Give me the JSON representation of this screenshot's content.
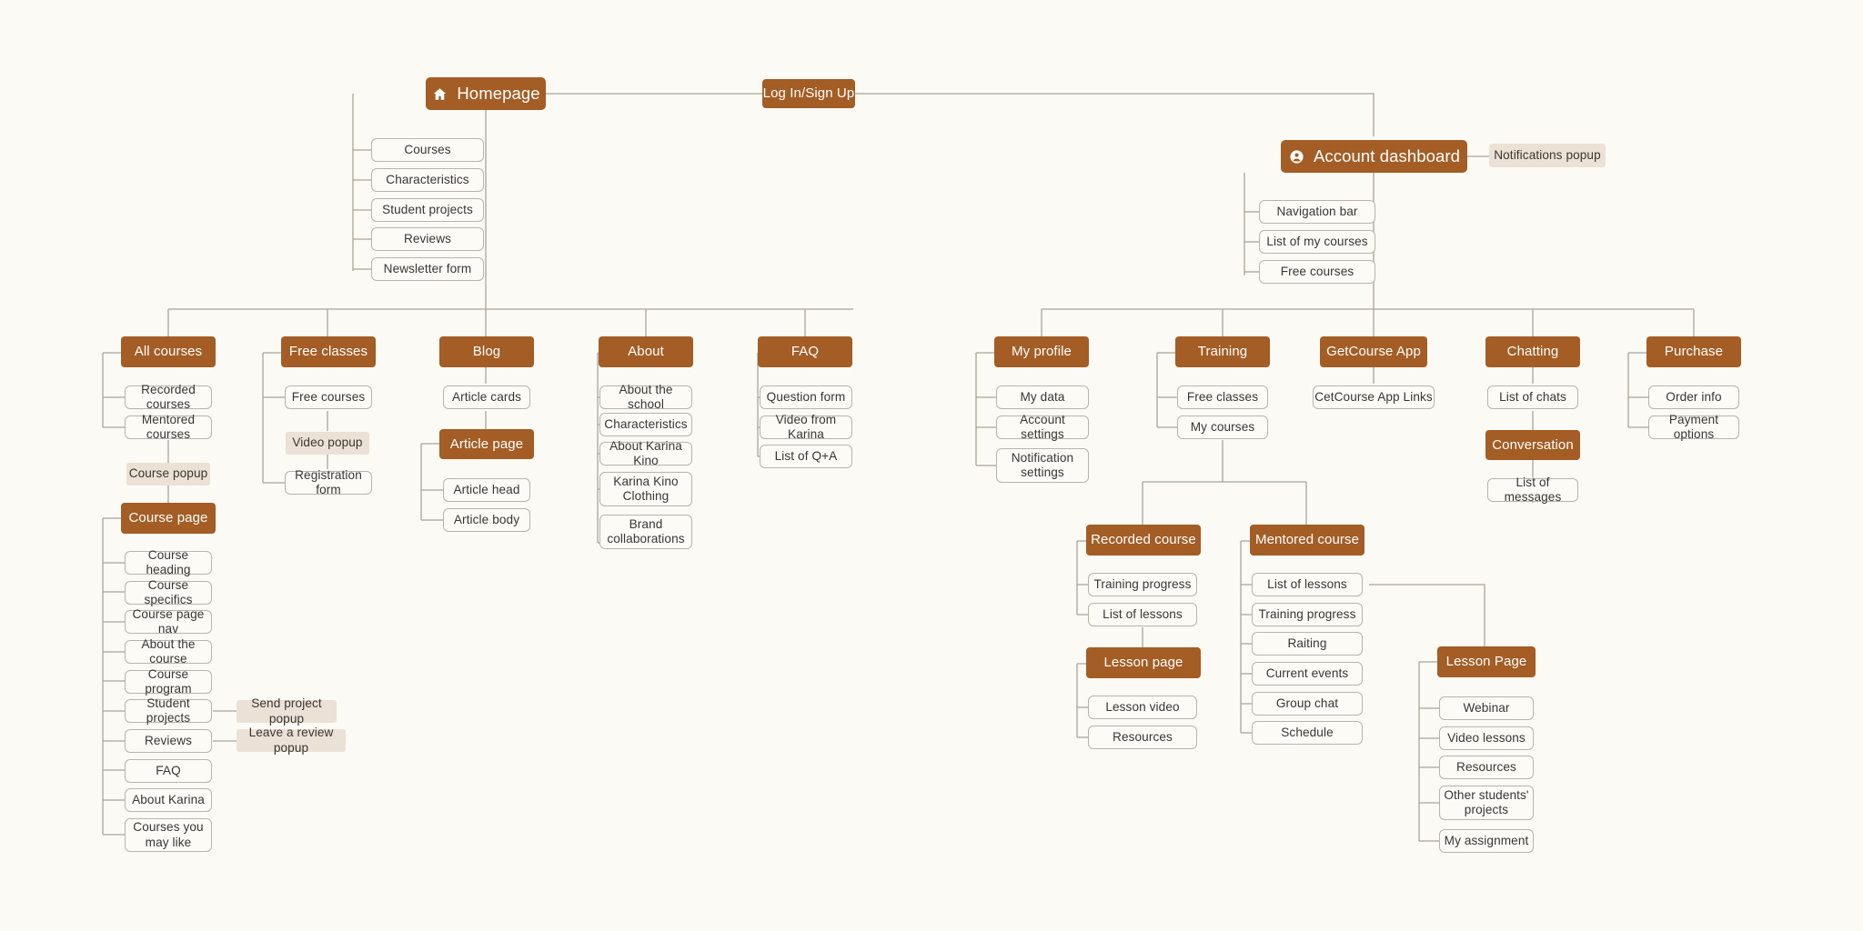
{
  "diagram": {
    "title": "Online course platform sitemap",
    "background_color": "#FBFAF4",
    "primary_color": "#A35D25",
    "popup_color": "#EBE1D6",
    "line_color": "#A9A49C"
  },
  "nodes": {
    "homepage": {
      "label": "Homepage",
      "icon": "home-icon"
    },
    "login": {
      "label": "Log In/Sign Up"
    },
    "account_dashboard": {
      "label": "Account dashboard",
      "icon": "user-account-icon"
    },
    "notifications_popup": {
      "label": "Notifications popup"
    },
    "home_children": [
      {
        "label": "Courses"
      },
      {
        "label": "Characteristics"
      },
      {
        "label": "Student projects"
      },
      {
        "label": "Reviews"
      },
      {
        "label": "Newsletter form"
      }
    ],
    "dashboard_children": [
      {
        "label": "Navigation bar"
      },
      {
        "label": "List of my courses"
      },
      {
        "label": "Free courses"
      }
    ],
    "all_courses": {
      "label": "All courses"
    },
    "all_courses_children": [
      {
        "label": "Recorded courses"
      },
      {
        "label": "Mentored courses"
      }
    ],
    "course_popup": {
      "label": "Course popup"
    },
    "course_page": {
      "label": "Course page"
    },
    "course_page_children": [
      {
        "label": "Course heading"
      },
      {
        "label": "Course specifics"
      },
      {
        "label": "Course page nav"
      },
      {
        "label": "About the course"
      },
      {
        "label": "Course program"
      },
      {
        "label": "Student projects"
      },
      {
        "label": "Reviews"
      },
      {
        "label": "FAQ"
      },
      {
        "label": "About Karina"
      },
      {
        "label": "Courses you\nmay like"
      }
    ],
    "send_project_popup": {
      "label": "Send project popup"
    },
    "leave_review_popup": {
      "label": "Leave a review popup"
    },
    "free_classes": {
      "label": "Free classes"
    },
    "free_classes_children": [
      {
        "label": "Free courses"
      },
      {
        "label": "Registration form"
      }
    ],
    "video_popup": {
      "label": "Video popup"
    },
    "blog": {
      "label": "Blog"
    },
    "article_cards": {
      "label": "Article cards"
    },
    "article_page": {
      "label": "Article page"
    },
    "article_page_children": [
      {
        "label": "Article head"
      },
      {
        "label": "Article body"
      }
    ],
    "about": {
      "label": "About"
    },
    "about_children": [
      {
        "label": "About the school"
      },
      {
        "label": "Characteristics"
      },
      {
        "label": "About Karina Kino"
      },
      {
        "label": "Karina Kino\nClothing"
      },
      {
        "label": "Brand\ncollaborations"
      }
    ],
    "faq": {
      "label": "FAQ"
    },
    "faq_children": [
      {
        "label": "Question form"
      },
      {
        "label": "Video from Karina"
      },
      {
        "label": "List of Q+A"
      }
    ],
    "my_profile": {
      "label": "My profile"
    },
    "my_profile_children": [
      {
        "label": "My data"
      },
      {
        "label": "Account settings"
      },
      {
        "label": "Notification\nsettings"
      }
    ],
    "training": {
      "label": "Training"
    },
    "training_children": [
      {
        "label": "Free classes"
      },
      {
        "label": "My courses"
      }
    ],
    "getcourse_app": {
      "label": "GetCourse App"
    },
    "getcourse_app_children": [
      {
        "label": "CetCourse App Links"
      }
    ],
    "chatting": {
      "label": "Chatting"
    },
    "list_of_chats": {
      "label": "List of chats"
    },
    "conversation": {
      "label": "Conversation"
    },
    "list_of_messages": {
      "label": "List of messages"
    },
    "purchase": {
      "label": "Purchase"
    },
    "purchase_children": [
      {
        "label": "Order info"
      },
      {
        "label": "Payment options"
      }
    ],
    "recorded_course": {
      "label": "Recorded course"
    },
    "recorded_course_children": [
      {
        "label": "Training progress"
      },
      {
        "label": "List of lessons"
      }
    ],
    "lesson_page_lower": {
      "label": "Lesson page"
    },
    "lesson_page_lower_children": [
      {
        "label": "Lesson video"
      },
      {
        "label": "Resources"
      }
    ],
    "mentored_course": {
      "label": "Mentored course"
    },
    "mentored_course_children": [
      {
        "label": "List of lessons"
      },
      {
        "label": "Training progress"
      },
      {
        "label": "Raiting"
      },
      {
        "label": "Current events"
      },
      {
        "label": "Group chat"
      },
      {
        "label": "Schedule"
      }
    ],
    "lesson_page_right": {
      "label": "Lesson Page"
    },
    "lesson_page_right_children": [
      {
        "label": "Webinar"
      },
      {
        "label": "Video lessons"
      },
      {
        "label": "Resources"
      },
      {
        "label": "Other students'\nprojects"
      },
      {
        "label": "My assignment"
      }
    ]
  }
}
